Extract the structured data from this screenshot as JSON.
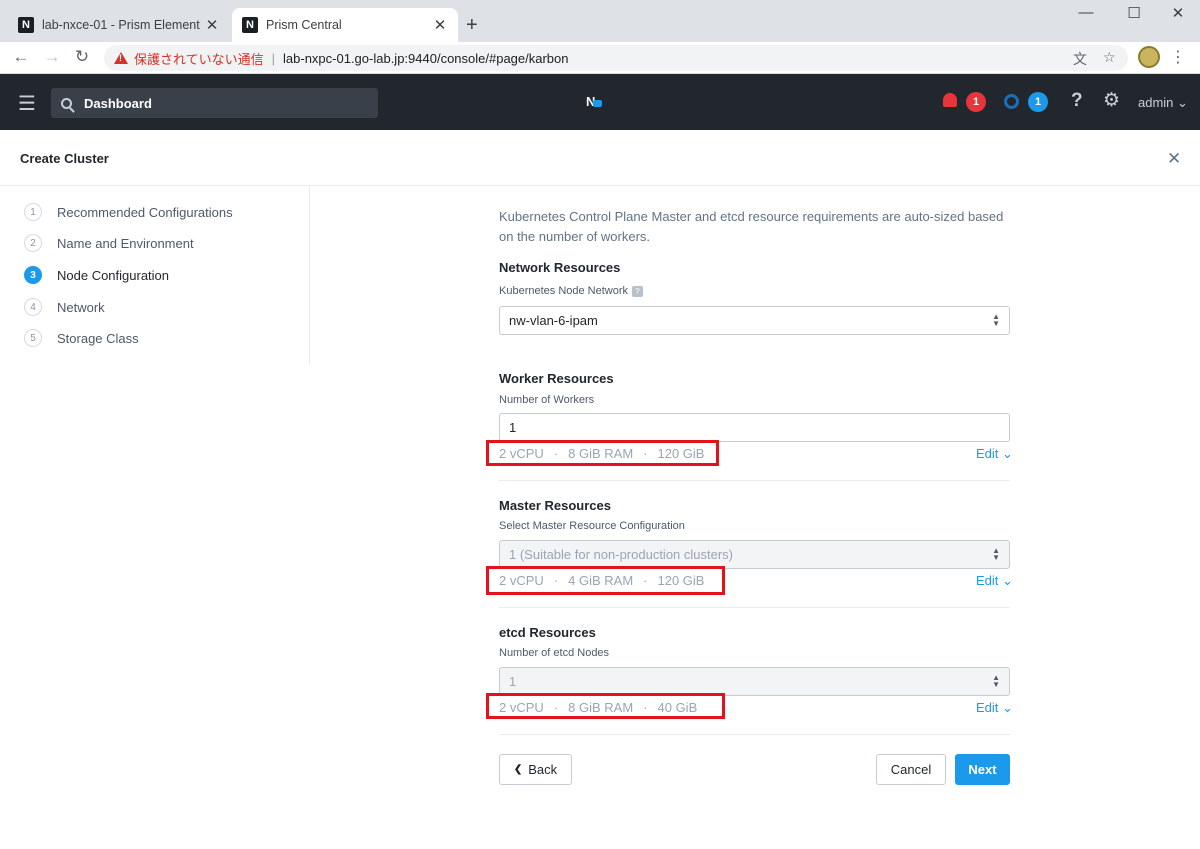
{
  "browser": {
    "tabs": [
      {
        "title": "lab-nxce-01 - Prism Element",
        "active": false
      },
      {
        "title": "Prism Central",
        "active": true
      }
    ],
    "new_tab": "+",
    "window_controls": [
      "—",
      "☐",
      "✕"
    ],
    "security_label": "保護されていない通信",
    "url": "lab-nxpc-01.go-lab.jp:9440/console/#page/karbon"
  },
  "header": {
    "search_text": "Dashboard",
    "logo_text": "N",
    "alerts_count": "1",
    "tasks_count": "1",
    "help_glyph": "?",
    "user": "admin ⌄",
    "colors": {
      "bar": "#22272e",
      "alert": "#e6353b",
      "accent": "#1b9aec"
    }
  },
  "modal": {
    "title": "Create Cluster",
    "steps": [
      {
        "num": "1",
        "label": "Recommended Configurations",
        "active": false
      },
      {
        "num": "2",
        "label": "Name and Environment",
        "active": false
      },
      {
        "num": "3",
        "label": "Node Configuration",
        "active": true
      },
      {
        "num": "4",
        "label": "Network",
        "active": false
      },
      {
        "num": "5",
        "label": "Storage Class",
        "active": false
      }
    ],
    "description": "Kubernetes Control Plane Master and etcd resource requirements are auto-sized based on the number of workers.",
    "network": {
      "title": "Network Resources",
      "label": "Kubernetes Node Network",
      "value": "nw-vlan-6-ipam"
    },
    "worker": {
      "title": "Worker Resources",
      "label": "Number of Workers",
      "value": "1",
      "vcpu": "2 vCPU",
      "ram": "8 GiB RAM",
      "disk": "120 GiB",
      "edit": "Edit ⌄"
    },
    "master": {
      "title": "Master Resources",
      "label": "Select Master Resource Configuration",
      "value": "1 (Suitable for non-production clusters)",
      "vcpu": "2 vCPU",
      "ram": "4 GiB RAM",
      "disk": "120 GiB",
      "edit": "Edit ⌄"
    },
    "etcd": {
      "title": "etcd Resources",
      "label": "Number of etcd Nodes",
      "value": "1",
      "vcpu": "2 vCPU",
      "ram": "8 GiB RAM",
      "disk": "40 GiB",
      "edit": "Edit ⌄"
    },
    "buttons": {
      "back": "Back",
      "cancel": "Cancel",
      "next": "Next"
    }
  }
}
